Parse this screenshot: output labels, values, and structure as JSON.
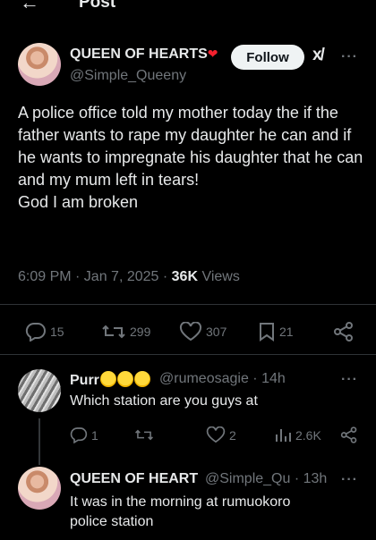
{
  "header": {
    "back_icon": "←",
    "title": "Post"
  },
  "post": {
    "author_name": "QUEEN OF HEARTS",
    "author_handle": "@Simple_Queeny",
    "follow_label": "Follow",
    "grok_icon": "x/",
    "more_icon": "···",
    "body": "A police office told my mother today the if the father wants to rape my daughter he can and if he wants to impregnate his daughter that he can and my mum left in tears!\nGod I am broken",
    "time": "6:09 PM · Jan 7, 2025 · ",
    "views_count": "36K",
    "views_label": " Views",
    "stats": {
      "replies": "15",
      "reposts": "299",
      "likes": "307",
      "bookmarks": "21"
    }
  },
  "replies": [
    {
      "author_name": "Purr",
      "handle_time": "@rumeosagie · 14h",
      "text": "Which station are you guys at",
      "more_icon": "···",
      "stats": {
        "replies": "1",
        "likes": "2",
        "views": "2.6K"
      }
    },
    {
      "author_name": "QUEEN OF HEART",
      "handle_time": "@Simple_Qu · 13h",
      "text": "It was in the morning at rumuokoro\npolice station",
      "more_icon": "···"
    }
  ]
}
